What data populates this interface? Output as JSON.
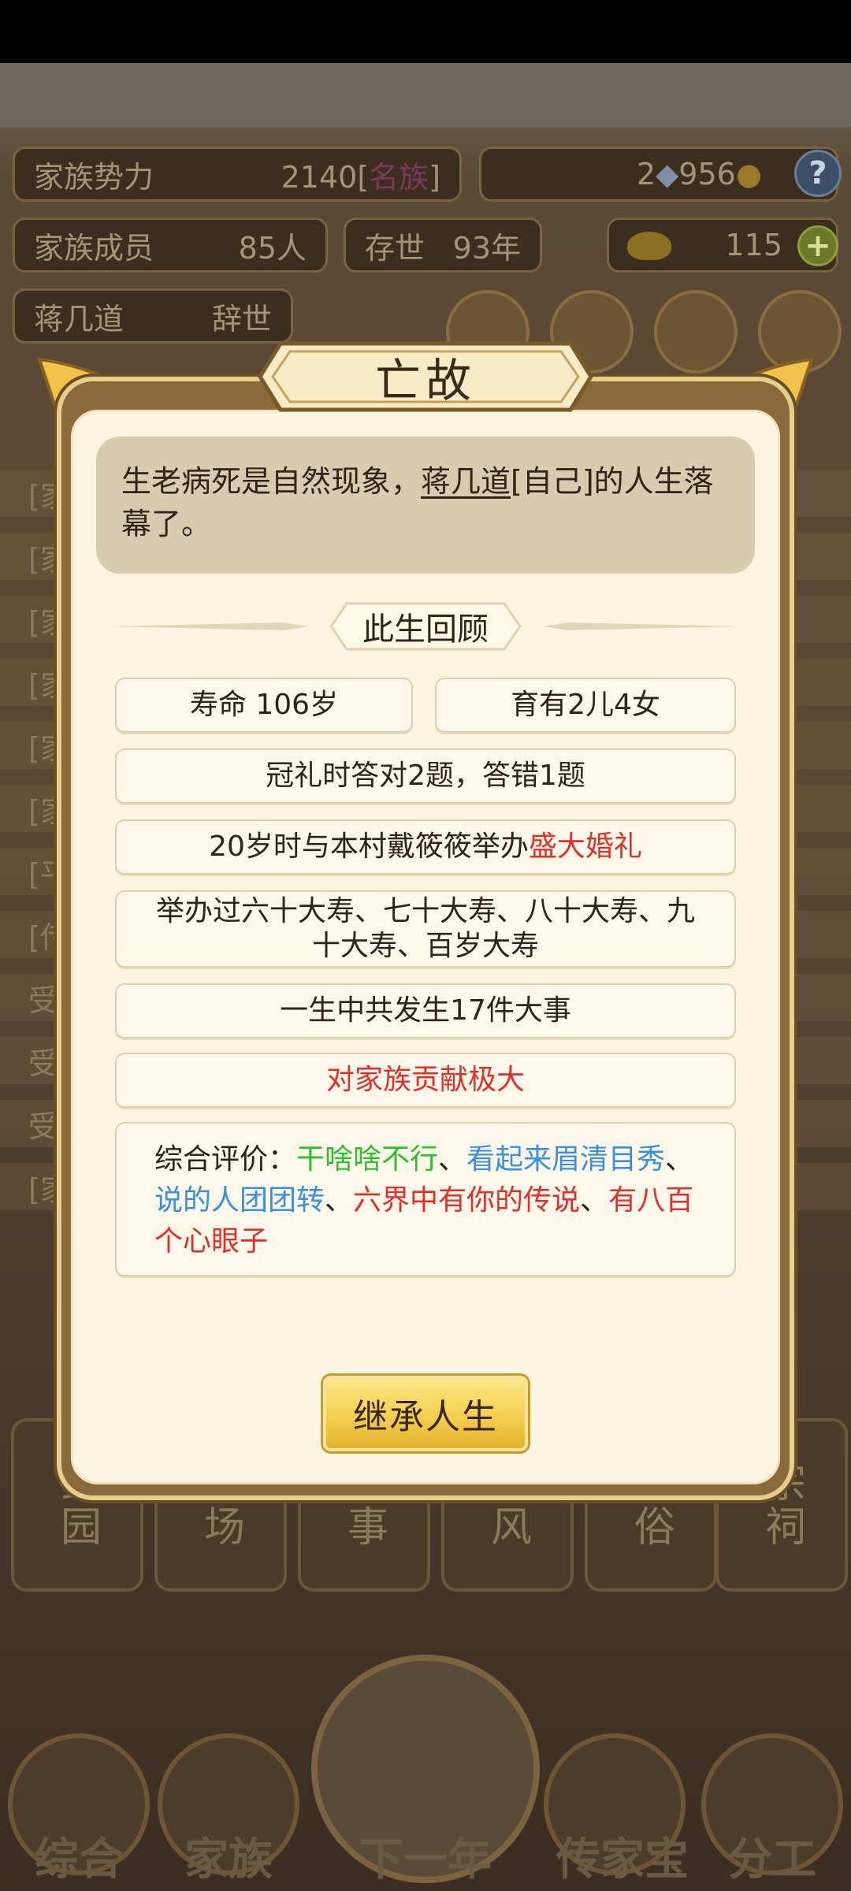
{
  "background": {
    "stats": {
      "power_label": "家族势力",
      "power_value": "2140",
      "power_tag": "名族",
      "currency_value": "2",
      "currency_value2": "956",
      "members_label": "家族成员",
      "members_value": "85人",
      "survival_label": "存世",
      "survival_value": "93年",
      "gold_value": "115",
      "patriarch_name": "蒋几道",
      "patriarch_status": "辞世"
    },
    "log_prefixes": [
      "[家",
      "[家",
      "[家",
      "[家",
      "[家",
      "[家",
      "[平",
      "[传",
      "受",
      "受",
      "受",
      "[家"
    ],
    "bottom_cards": [
      "药园",
      "市场",
      "政事",
      "家风",
      "习俗",
      "宗祠"
    ],
    "nav": [
      "综合",
      "家族",
      "下一年",
      "传家宝",
      "分工"
    ]
  },
  "dialog": {
    "title": "亡故",
    "intro_before": "生老病死是自然现象，",
    "intro_name": "蒋几道",
    "intro_after": "[自己]的人生落幕了。",
    "section_title": "此生回顾",
    "lifespan": "寿命 106岁",
    "children": "育有2儿4女",
    "coming_of_age": "冠礼时答对2题，答错1题",
    "marriage_text": "20岁时与本村戴筱筱举办",
    "marriage_highlight": "盛大婚礼",
    "birthdays": "举办过六十大寿、七十大寿、八十大寿、九十大寿、百岁大寿",
    "events": "一生中共发生17件大事",
    "contribution": "对家族贡献极大",
    "evaluation": {
      "label": "综合评价：",
      "items": [
        {
          "text": "干啥啥不行",
          "color": "#2ebf2e"
        },
        {
          "text": "看起来眉清目秀",
          "color": "#3a8fe0"
        },
        {
          "text": "说的人团团转",
          "color": "#3a8fe0"
        },
        {
          "text": "六界中有你的传说",
          "color": "#e0302a"
        },
        {
          "text": "有八百个心眼子",
          "color": "#e0302a"
        }
      ],
      "separator": "、"
    },
    "inherit_button": "继承人生"
  }
}
